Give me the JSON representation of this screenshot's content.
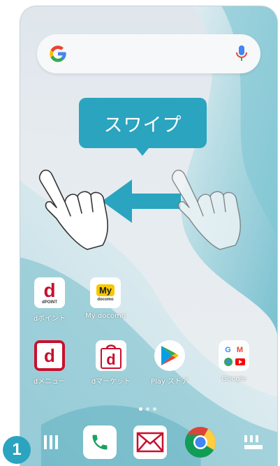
{
  "search": {
    "logo": "G",
    "mic_icon": "mic-icon"
  },
  "callout": {
    "text": "スワイプ"
  },
  "apps": [
    {
      "name": "dpoint",
      "label": "dポイント",
      "icon_text": "d",
      "icon_sub": "dPOINT"
    },
    {
      "name": "mydocomo",
      "label": "My docomo",
      "icon_text": "My",
      "icon_sub": "docomo"
    },
    {
      "name": "dmenu",
      "label": "dメニュー",
      "icon_text": "d"
    },
    {
      "name": "dmarket",
      "label": "dマーケット",
      "icon_text": "d"
    },
    {
      "name": "playstore",
      "label": "Play ストア"
    },
    {
      "name": "google-folder",
      "label": "Google",
      "icon_letters": [
        "G",
        "M"
      ]
    }
  ],
  "step": {
    "number": "1"
  },
  "colors": {
    "accent": "#2aa4bf",
    "docomo_red": "#c8102e",
    "my_yellow": "#f7c800"
  }
}
